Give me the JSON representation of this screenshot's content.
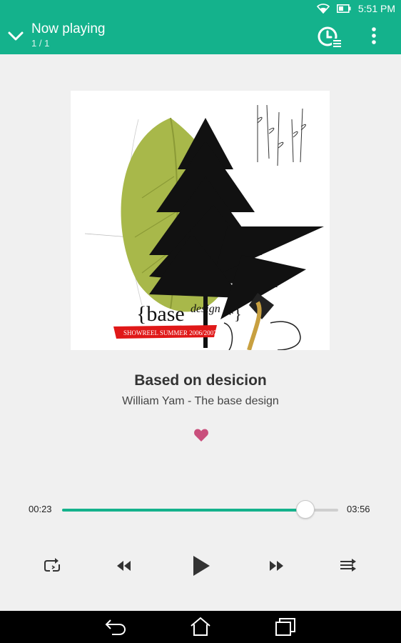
{
  "status_bar": {
    "time": "5:51 PM",
    "icons": [
      "wifi-icon",
      "battery-icon"
    ]
  },
  "app_bar": {
    "title": "Now playing",
    "queue_position": "1 / 1",
    "icons": [
      "chevron-down-icon",
      "sleep-timer-icon",
      "more-vert-icon"
    ]
  },
  "album_art": {
    "brand": "{base",
    "brand_sub": "design",
    "star": "*}",
    "banner": "SHOWREEL SUMMER 2006/2007"
  },
  "track": {
    "title": "Based on desicion",
    "artist_album": "William Yam - The base design",
    "favorite": true
  },
  "playback": {
    "elapsed": "00:23",
    "duration": "03:56",
    "progress_fraction": 0.88
  },
  "controls": [
    "repeat-icon",
    "rewind-icon",
    "play-icon",
    "fast-forward-icon",
    "shuffle-icon"
  ],
  "colors": {
    "accent": "#14b28c",
    "heart": "#c94f7c",
    "background": "#f0f0f0"
  },
  "nav_bar": [
    "back-icon",
    "home-icon",
    "recents-icon"
  ]
}
